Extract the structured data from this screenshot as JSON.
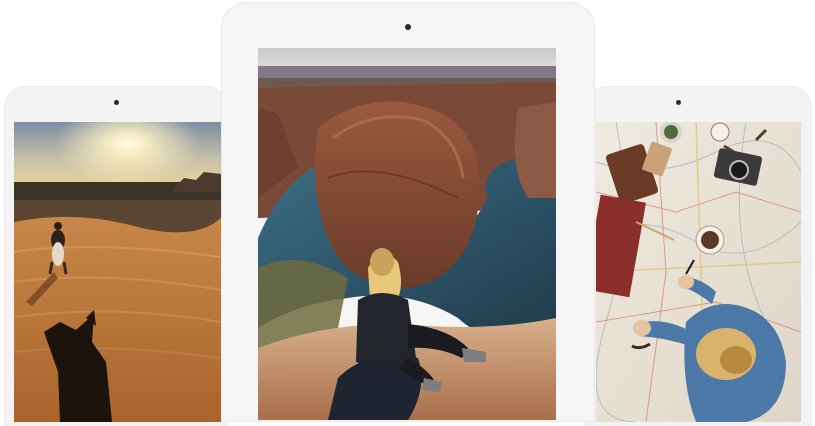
{
  "devices": [
    {
      "id": "left",
      "photo": "desert-horse-rider-sunset",
      "orientation": "portrait"
    },
    {
      "id": "center",
      "photo": "canyon-river-bend-woman-seated",
      "orientation": "portrait"
    },
    {
      "id": "right",
      "photo": "travel-map-flatlay-woman-writing",
      "orientation": "portrait"
    }
  ],
  "colors": {
    "device_frame": "#f3f3f3",
    "background": "#ffffff",
    "camera": "#2a2a2a"
  }
}
